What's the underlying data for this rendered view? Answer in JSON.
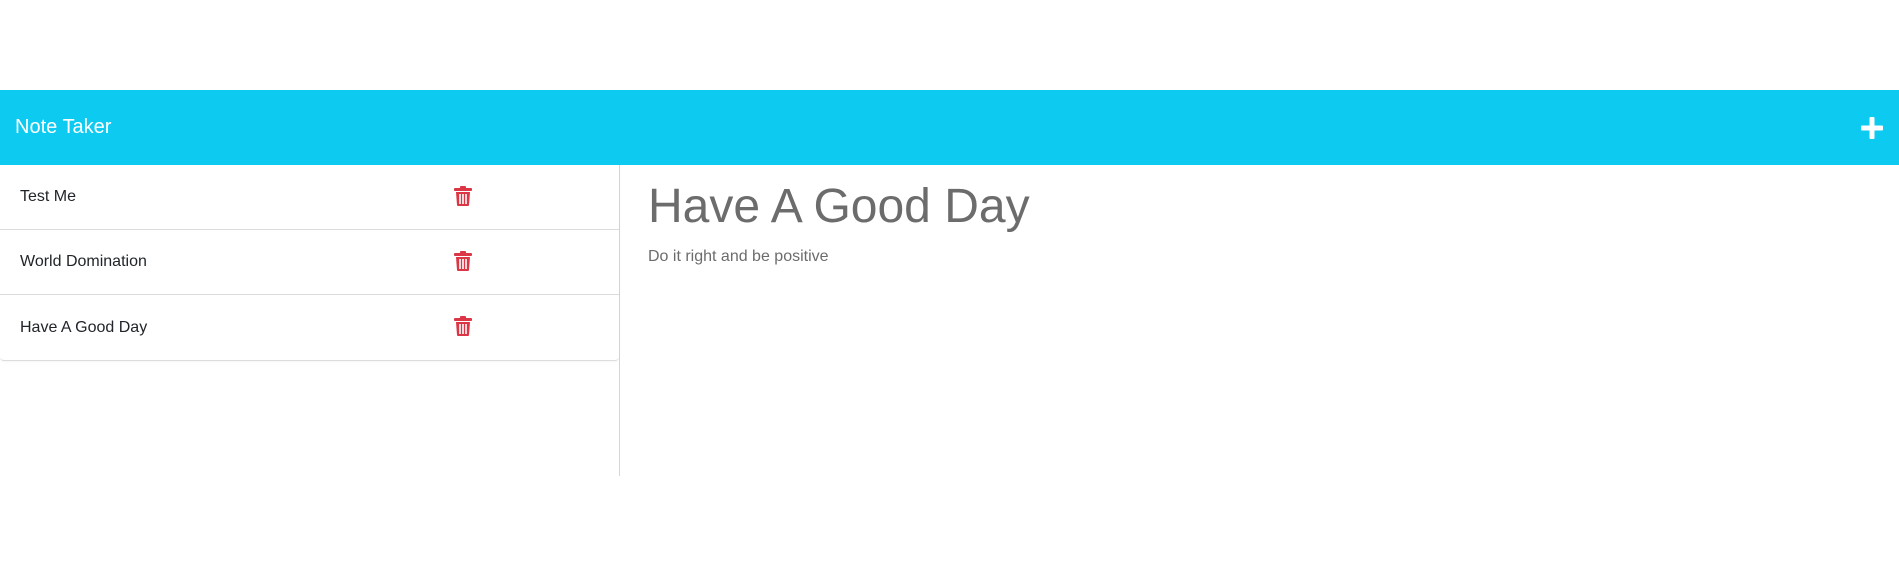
{
  "colors": {
    "navbar_bg": "#0dcaf0",
    "navbar_text": "#ffffff",
    "delete_icon": "#dc3545",
    "note_text": "#6c6c6c"
  },
  "navbar": {
    "title": "Note Taker",
    "new_note_icon": "plus-icon"
  },
  "notes": [
    {
      "title": "Test Me",
      "delete_icon": "trash-icon"
    },
    {
      "title": "World Domination",
      "delete_icon": "trash-icon"
    },
    {
      "title": "Have A Good Day",
      "delete_icon": "trash-icon"
    }
  ],
  "active_note": {
    "title": "Have A Good Day",
    "text": "Do it right and be positive"
  }
}
